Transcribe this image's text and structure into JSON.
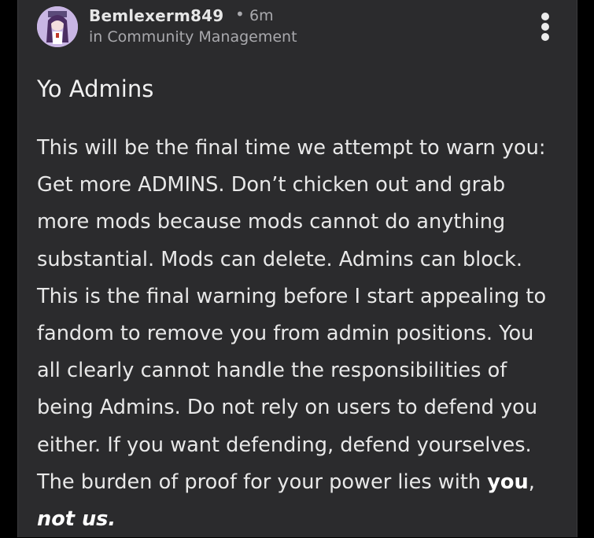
{
  "post": {
    "author": {
      "username": "Bemlexerm849",
      "avatar_icon": "anime-character-avatar-icon"
    },
    "separator": "•",
    "time": "6m",
    "community": "in Community Management",
    "title": "Yo Admins",
    "body_lines": [
      "This will be the final time we attempt to warn you:",
      "Get more ADMINS. Don’t chicken out and grab",
      "more mods because mods cannot do anything",
      "substantial. Mods can delete. Admins can block.",
      "This is the final warning before I start appealing to",
      "fandom to remove you from admin positions. You",
      "all clearly cannot handle the responsibilities of",
      "being Admins. Do not rely on users to defend you",
      "either. If you want defending, defend yourselves."
    ],
    "last_line": {
      "text": "The burden of proof for your power lies with ",
      "bold": "you",
      "comma": ",",
      "final_bold_italic": "not us."
    },
    "menu_icon": "more-vertical-icon"
  },
  "colors": {
    "background": "#000000",
    "card": "#2b2b2d",
    "text_primary": "#e8e8e8",
    "text_secondary": "#a9a9ad",
    "avatar_bg": "#c9b6e4"
  }
}
